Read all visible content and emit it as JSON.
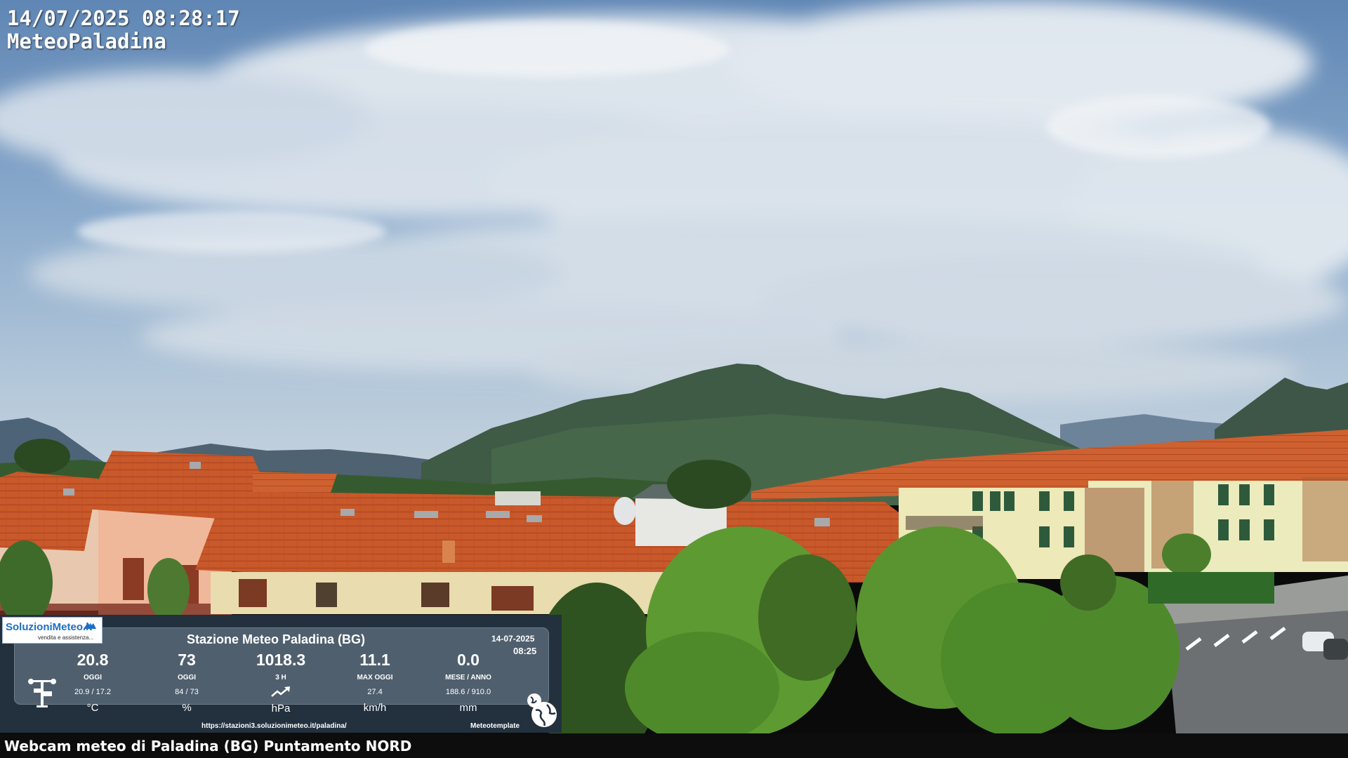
{
  "overlay": {
    "timestamp": "14/07/2025 08:28:17",
    "site_name": "MeteoPaladina"
  },
  "caption": "Webcam meteo di Paladina (BG) Puntamento NORD",
  "station": {
    "logo_text": "SoluzioniMeteo.it",
    "logo_tagline": "vendita e assistenza...",
    "title": "Stazione Meteo Paladina (BG)",
    "date": "14-07-2025",
    "time": "08:25",
    "readings": [
      {
        "value": "20.8",
        "label": "OGGI",
        "sub": "20.9 / 17.2",
        "unit": "°C"
      },
      {
        "value": "73",
        "label": "OGGI",
        "sub": "84 / 73",
        "unit": "%"
      },
      {
        "value": "1018.3",
        "label": "3 H",
        "sub": "",
        "trend_icon": "trending-up-icon",
        "unit": "hPa"
      },
      {
        "value": "11.1",
        "label": "MAX OGGI",
        "sub": "27.4",
        "unit": "km/h"
      },
      {
        "value": "0.0",
        "label": "MESE / ANNO",
        "sub": "188.6 / 910.0",
        "unit": "mm"
      }
    ],
    "url": "https://stazioni3.soluzionimeteo.it/paladina/",
    "brand": "Meteotemplate",
    "icons": {
      "station": "weather-station-icon",
      "globe": "globe-icon"
    }
  },
  "colors": {
    "sky": "#7fa3c9",
    "roof": "#c9582a",
    "mountain": "#3f5a45",
    "panel": "#23303e",
    "panel_inner": "#4f5f6e"
  }
}
